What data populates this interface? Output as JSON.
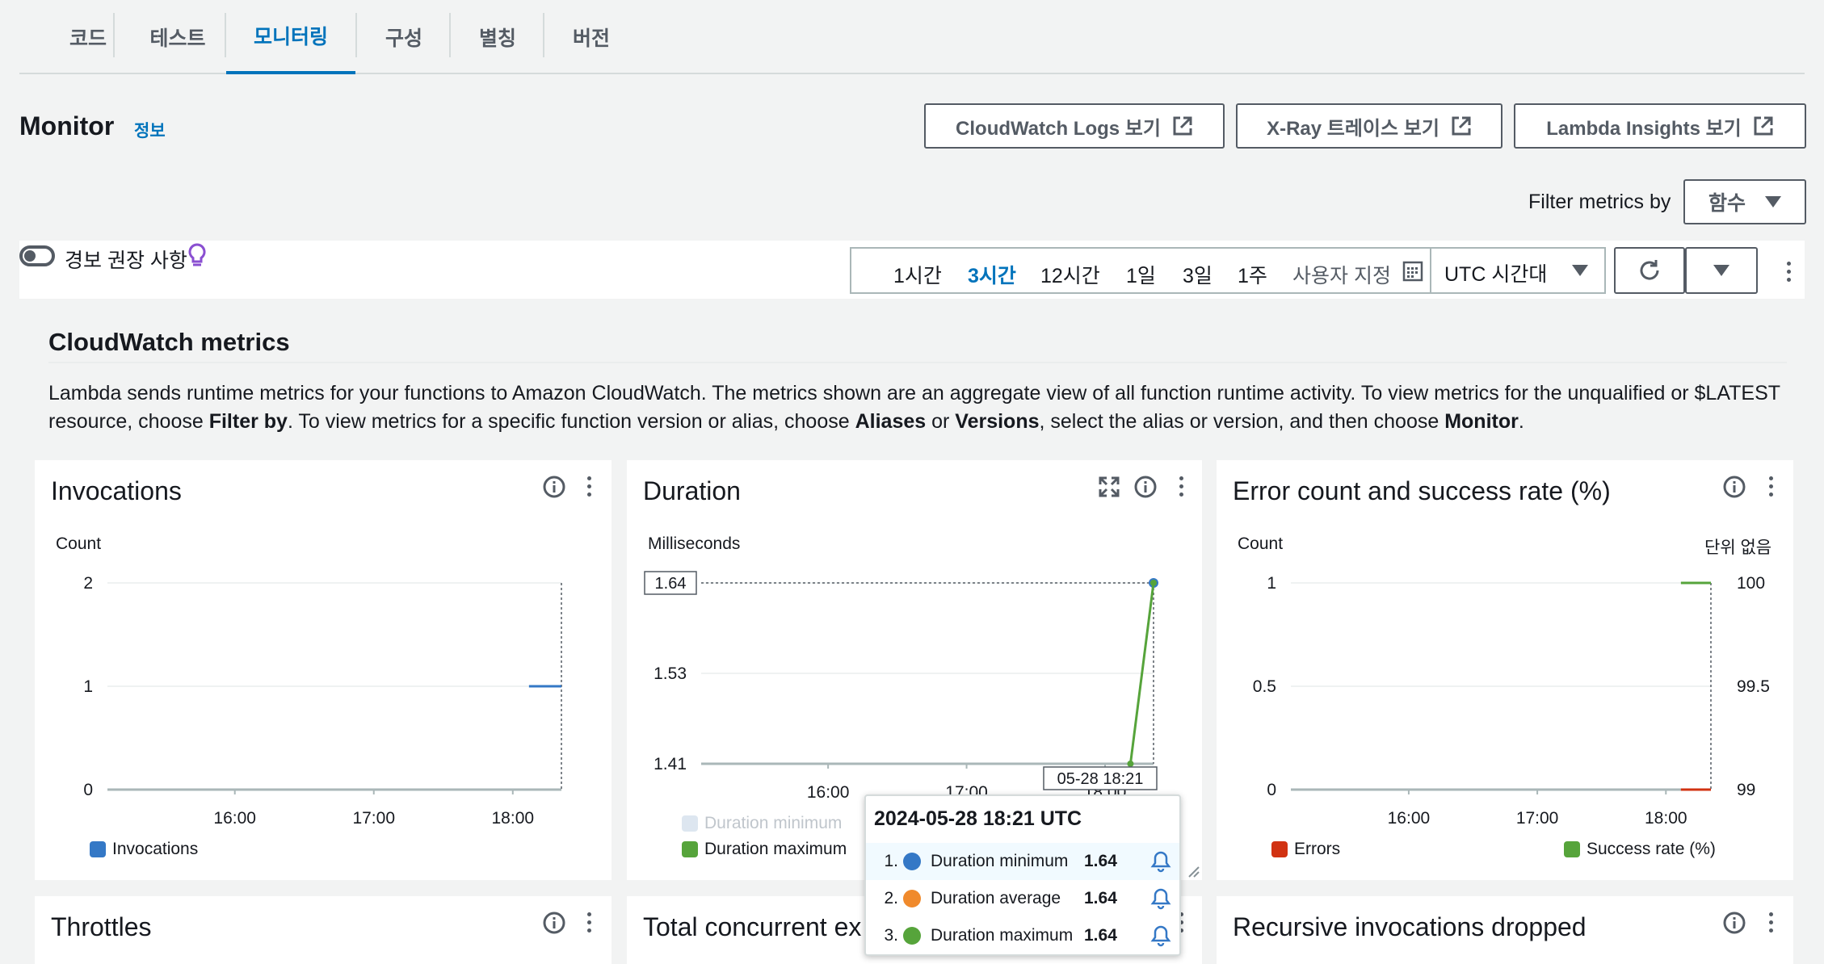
{
  "tabs": [
    {
      "label": "코드"
    },
    {
      "label": "테스트"
    },
    {
      "label": "모니터링"
    },
    {
      "label": "구성"
    },
    {
      "label": "별칭"
    },
    {
      "label": "버전"
    }
  ],
  "header": {
    "title": "Monitor",
    "info": "정보",
    "buttons": [
      {
        "label": "CloudWatch Logs 보기"
      },
      {
        "label": "X-Ray 트레이스 보기"
      },
      {
        "label": "Lambda Insights 보기"
      }
    ],
    "filter_label": "Filter metrics by",
    "filter_value": "함수"
  },
  "toolbar": {
    "alarm_label": "경보 권장 사항",
    "ranges": [
      "1시간",
      "3시간",
      "12시간",
      "1일",
      "3일",
      "1주"
    ],
    "active_range": "3시간",
    "custom": "사용자 지정",
    "timezone": "UTC 시간대"
  },
  "cloudwatch": {
    "title": "CloudWatch metrics",
    "desc_1": "Lambda sends runtime metrics for your functions to Amazon CloudWatch. The metrics shown are an aggregate view of all function runtime activity. To view metrics for the unqualified or $LATEST resource, choose ",
    "desc_b1": "Filter by",
    "desc_2": ". To view metrics for a specific function version or alias, choose ",
    "desc_b2": "Aliases",
    "desc_3": " or ",
    "desc_b3": "Versions",
    "desc_4": ", select the alias or version, and then choose ",
    "desc_b4": "Monitor",
    "desc_5": "."
  },
  "cards": {
    "invocations": {
      "title": "Invocations",
      "ylabel": "Count",
      "legend": "Invocations"
    },
    "duration": {
      "title": "Duration",
      "ylabel": "Milliseconds",
      "legend_min": "Duration minimum",
      "legend_max": "Duration maximum",
      "value_label": "1.64",
      "time_label": "05-28 18:21",
      "partial_tick": "17:00",
      "partial_tick_2": "18:00"
    },
    "errors": {
      "title": "Error count and success rate (%)",
      "ylabel": "Count",
      "ylabel_right": "단위 없음",
      "legend_errors": "Errors",
      "legend_success": "Success rate (%)"
    },
    "throttles": {
      "title": "Throttles"
    },
    "concurrent": {
      "title": "Total concurrent ex"
    },
    "recursive": {
      "title": "Recursive invocations dropped"
    }
  },
  "chart_data": [
    {
      "type": "line",
      "title": "Invocations",
      "ylabel": "Count",
      "yticks": [
        "0",
        "1",
        "2"
      ],
      "xticks": [
        "16:00",
        "17:00",
        "18:00"
      ],
      "ylim": [
        0,
        2
      ],
      "series": [
        {
          "name": "Invocations",
          "color": "#3478c6",
          "points": [
            [
              "18:07",
              1
            ],
            [
              "18:21",
              1
            ]
          ]
        }
      ]
    },
    {
      "type": "line",
      "title": "Duration",
      "ylabel": "Milliseconds",
      "yticks": [
        "1.41",
        "1.53",
        "1.64"
      ],
      "xticks": [
        "16:00",
        "17:00",
        "18:00"
      ],
      "ylim": [
        1.41,
        1.64
      ],
      "series": [
        {
          "name": "Duration minimum",
          "color": "#3478c6",
          "points": [
            [
              "18:21",
              1.64
            ]
          ]
        },
        {
          "name": "Duration maximum",
          "color": "#56a43b",
          "points": [
            [
              "18:11",
              1.41
            ],
            [
              "18:21",
              1.64
            ]
          ]
        }
      ]
    },
    {
      "type": "line",
      "title": "Error count and success rate (%)",
      "ylabel": "Count",
      "ylabel_right": "단위 없음",
      "yticks": [
        "0",
        "0.5",
        "1"
      ],
      "yticks_right": [
        "99",
        "99.5",
        "100"
      ],
      "xticks": [
        "16:00",
        "17:00",
        "18:00"
      ],
      "ylim": [
        0,
        1
      ],
      "ylim_right": [
        99,
        100
      ],
      "series": [
        {
          "name": "Errors",
          "color": "#d13212",
          "points": [
            [
              "18:07",
              0
            ],
            [
              "18:21",
              0
            ]
          ]
        },
        {
          "name": "Success rate (%)",
          "color": "#56a43b",
          "points": [
            [
              "18:07",
              100
            ],
            [
              "18:21",
              100
            ]
          ]
        }
      ]
    }
  ],
  "tooltip": {
    "title": "2024-05-28 18:21 UTC",
    "rows": [
      {
        "num": "1.",
        "name": "Duration minimum",
        "value": "1.64",
        "color": "#3478c6"
      },
      {
        "num": "2.",
        "name": "Duration average",
        "value": "1.64",
        "color": "#f08a2c"
      },
      {
        "num": "3.",
        "name": "Duration maximum",
        "value": "1.64",
        "color": "#56a43b"
      }
    ]
  },
  "colors": {
    "accent": "#0073bb",
    "blue": "#3478c6",
    "green": "#56a43b",
    "red": "#d13212",
    "orange": "#f08a2c"
  }
}
